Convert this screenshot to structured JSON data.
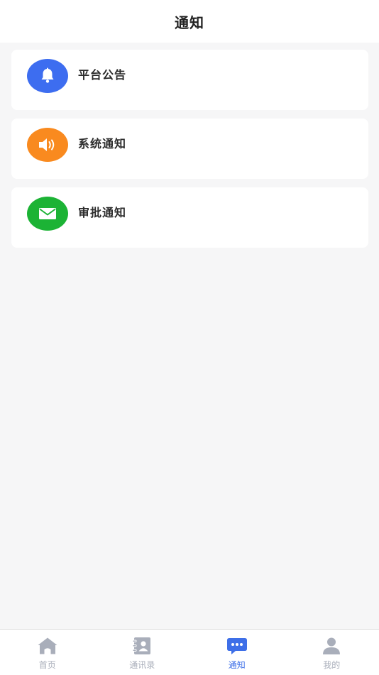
{
  "header": {
    "title": "通知"
  },
  "notifications": [
    {
      "label": "平台公告",
      "icon": "bell-icon",
      "color": "#3d6df0"
    },
    {
      "label": "系统通知",
      "icon": "speaker-icon",
      "color": "#f98a1f"
    },
    {
      "label": "审批通知",
      "icon": "mail-icon",
      "color": "#1cb335"
    }
  ],
  "tabbar": {
    "active": "通知",
    "active_color": "#3e6fe8",
    "inactive_color": "#a9aeba",
    "items": [
      {
        "label": "首页",
        "icon": "home-icon"
      },
      {
        "label": "通讯录",
        "icon": "contacts-icon"
      },
      {
        "label": "通知",
        "icon": "message-icon"
      },
      {
        "label": "我的",
        "icon": "user-icon"
      }
    ]
  }
}
